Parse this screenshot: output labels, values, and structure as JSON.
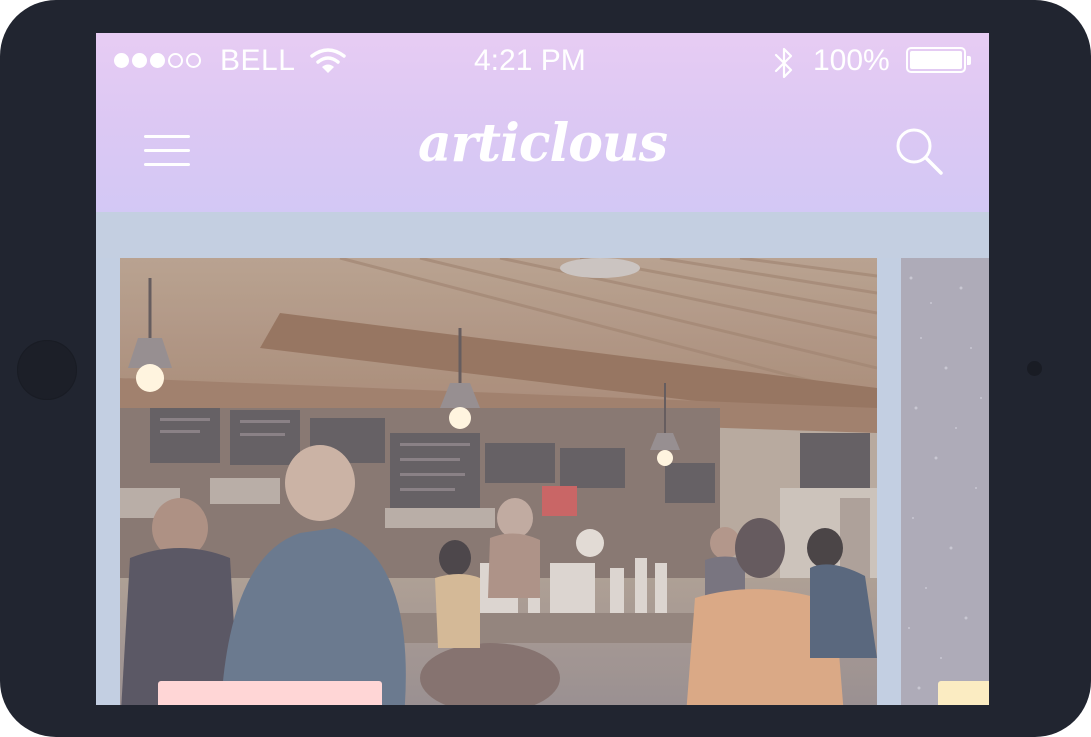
{
  "status_bar": {
    "carrier": "BELL",
    "time": "4:21 PM",
    "battery_percent_text": "100%",
    "signal_bars_filled": 3,
    "signal_bars_total": 5,
    "battery_level": 1.0
  },
  "header": {
    "logo_text": "articlous",
    "menu_icon": "hamburger-menu-icon",
    "search_icon": "search-icon"
  },
  "colors": {
    "device_frame": "#212530",
    "header_top": "#e7ccf3",
    "header_bottom": "#d3c8f5",
    "content_background": "#c3cfe2",
    "card_tag_primary": "#ffd6d6",
    "card_tag_secondary": "#fbecc2"
  },
  "cards": [
    {
      "image": "cafe-interior-photo",
      "tag_color": "#ffd6d6"
    },
    {
      "image": "dark-speckled-photo",
      "tag_color": "#fbecc2"
    }
  ]
}
